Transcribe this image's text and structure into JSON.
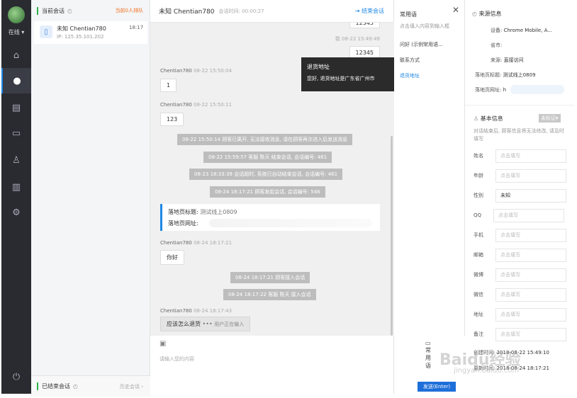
{
  "nav": {
    "status": "在线"
  },
  "conv": {
    "current_label": "当前会话",
    "queue": "当前0人排队",
    "item": {
      "name": "未知 Chentian780",
      "time": "18:17",
      "ip": "IP: 125.35.101.202"
    },
    "ended_label": "已结束会话",
    "history": "历史会话"
  },
  "chat": {
    "title": "未知 Chentian780",
    "duration": "会话时间: 00:00:27",
    "end_btn": "结束会话",
    "msgs": {
      "top_cut": "12345",
      "me_meta": "我 08-22 15:49:49",
      "me_text": "12345",
      "a_name": "Chentian780",
      "a_time": "08-22 15:50:04",
      "a_text": "1",
      "b_name": "Chentian780",
      "b_time": "08-22 15:50:11",
      "b_text": "123",
      "s1": "08-22 15:50:14 顾客已离开, 无法接收消息, 请在顾客再次进入后发送消息",
      "s2": "08-22 15:59:57 客服 陈天 结束会话, 会话编号: 461",
      "s3": "08-23 18:33:39 会话超时, 系统已自动结束会话, 会话编号: 461",
      "s4": "08-24 18:17:21 顾客发起会话, 会话编号: 546",
      "lp_title_label": "落地页标题:",
      "lp_title": "测试线上0809",
      "lp_url_label": "落地页网址:",
      "c_name": "Chentian780",
      "c_time": "08-24 18:17:21",
      "c_text": "你好",
      "s5": "08-24 18:17:21 顾客接入会话",
      "s6": "08-24 18:17:22 客服 陈天 接入会话",
      "d_name": "Chentian780",
      "d_time": "08-24 18:17:43",
      "d_text": "应该怎么退货",
      "typing": "用户正在输入"
    },
    "placeholder": "请输入您的内容",
    "phrase_btn": "常用语",
    "send": "发送(Enter)"
  },
  "tooltip": {
    "title": "退货地址",
    "body": "您好, 退货地址是广东省广州市"
  },
  "phrases": {
    "title": "常用语",
    "hint": "点击填入内容到输入框",
    "items": [
      "问好 (示例常用语...",
      "联系方式",
      "退货地址"
    ]
  },
  "info": {
    "source_title": "来源信息",
    "device_l": "设备:",
    "device": "Chrome Mobile, A...",
    "prov_l": "省市:",
    "src_l": "来源:",
    "src": "直接访问",
    "lp_title_l": "落地页标题:",
    "lp_title": "测试线上0809",
    "lp_url_l": "落地页网址:",
    "lp_url": "h",
    "basic_title": "基本信息",
    "tag": "未标记▾",
    "note": "对话结束后, 顾客信息将无法修改, 请及时填写",
    "fields": [
      {
        "label": "姓名",
        "value": "点击填写"
      },
      {
        "label": "年龄",
        "value": "点击填写"
      },
      {
        "label": "性别",
        "value": "未知"
      },
      {
        "label": "QQ",
        "value": "点击填写"
      },
      {
        "label": "手机",
        "value": "点击填写"
      },
      {
        "label": "邮箱",
        "value": "点击填写"
      },
      {
        "label": "微博",
        "value": "点击填写"
      },
      {
        "label": "微信",
        "value": "点击填写"
      },
      {
        "label": "地址",
        "value": "点击填写"
      },
      {
        "label": "备注",
        "value": "点击填写"
      }
    ],
    "created_l": "创建时间:",
    "created": "2018-08-22 15:49:10",
    "updated_l": "更新时间:",
    "updated": "2018-08-24 18:17:21"
  },
  "watermark": "Baidu经验",
  "watermark_url": "jingyan.baidu.com"
}
